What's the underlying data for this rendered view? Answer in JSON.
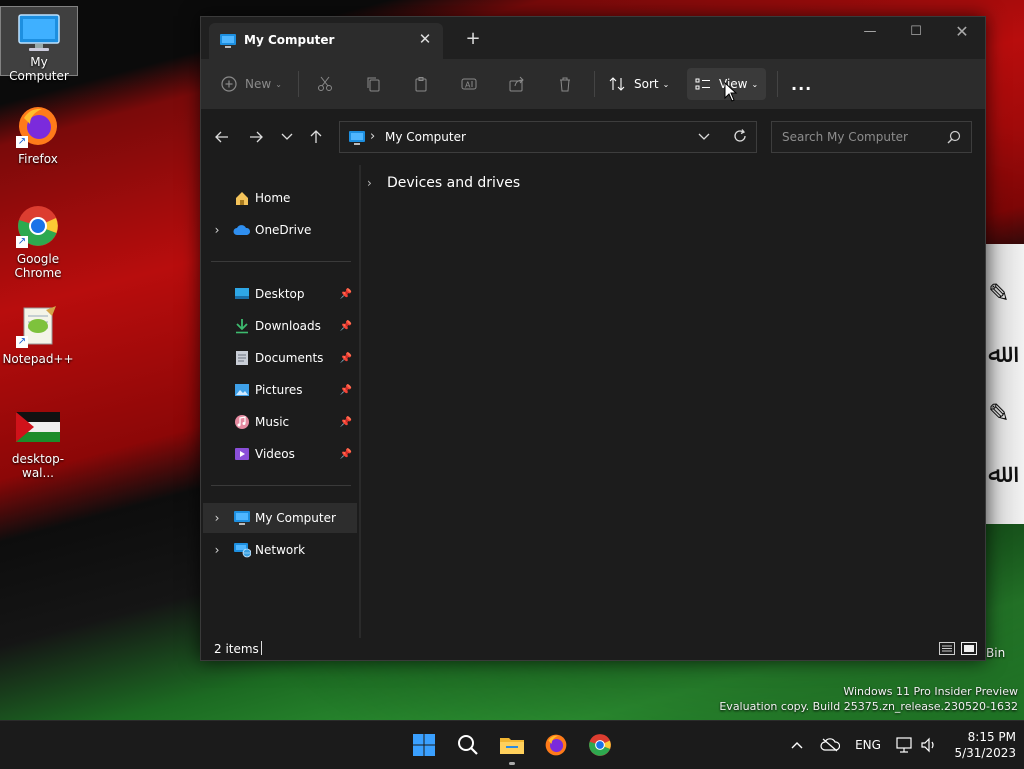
{
  "desktop": {
    "icons": [
      {
        "label": "My Computer"
      },
      {
        "label": "Firefox"
      },
      {
        "label": "Google Chrome"
      },
      {
        "label": "Notepad++"
      },
      {
        "label": "desktop-wal..."
      }
    ],
    "recycle_bin_label_fragment": "Bin"
  },
  "watermark": {
    "line1": "Windows 11 Pro Insider Preview",
    "line2": "Evaluation copy. Build 25375.zn_release.230520-1632"
  },
  "explorer": {
    "tab_title": "My Computer",
    "toolbar": {
      "new_label": "New",
      "sort_label": "Sort",
      "view_label": "View",
      "more_label": "..."
    },
    "address": {
      "crumb": "My Computer",
      "search_placeholder": "Search My Computer"
    },
    "nav": {
      "home": "Home",
      "onedrive": "OneDrive",
      "desktop": "Desktop",
      "downloads": "Downloads",
      "documents": "Documents",
      "pictures": "Pictures",
      "music": "Music",
      "videos": "Videos",
      "my_computer": "My Computer",
      "network": "Network"
    },
    "content": {
      "group_label": "Devices and drives"
    },
    "status": {
      "item_count": "2 items"
    }
  },
  "taskbar": {
    "language": "ENG",
    "time": "8:15 PM",
    "date": "5/31/2023"
  },
  "colors": {
    "window_bg": "#1c1c1c",
    "toolbar_bg": "#2c2c2c",
    "taskbar_bg": "#1b1b1b",
    "accent_blue": "#0a84d8"
  }
}
